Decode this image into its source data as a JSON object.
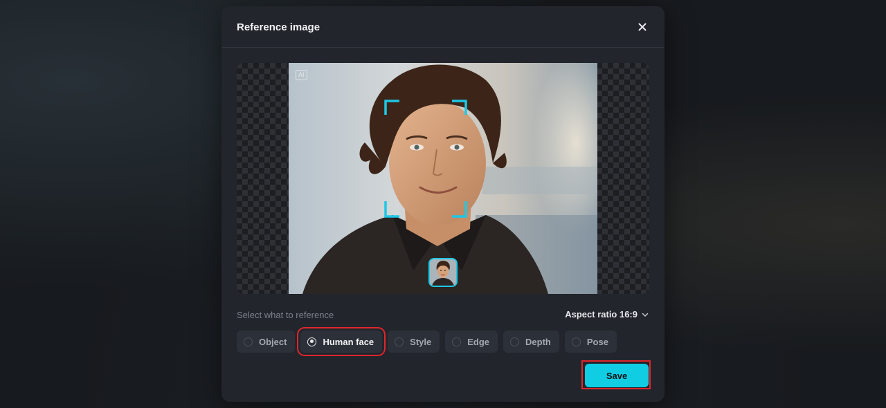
{
  "dialog": {
    "title": "Reference image",
    "close_icon": "close-icon"
  },
  "preview": {
    "badge": "AI",
    "face_frame_color": "#1ec8e6"
  },
  "reference": {
    "label": "Select what to reference",
    "aspect_ratio": "Aspect ratio 16:9",
    "options": [
      {
        "label": "Object",
        "selected": false
      },
      {
        "label": "Human face",
        "selected": true
      },
      {
        "label": "Style",
        "selected": false
      },
      {
        "label": "Edge",
        "selected": false
      },
      {
        "label": "Depth",
        "selected": false
      },
      {
        "label": "Pose",
        "selected": false
      }
    ]
  },
  "actions": {
    "save_label": "Save",
    "accent": "#11cde3",
    "highlight": "#e0262b"
  }
}
